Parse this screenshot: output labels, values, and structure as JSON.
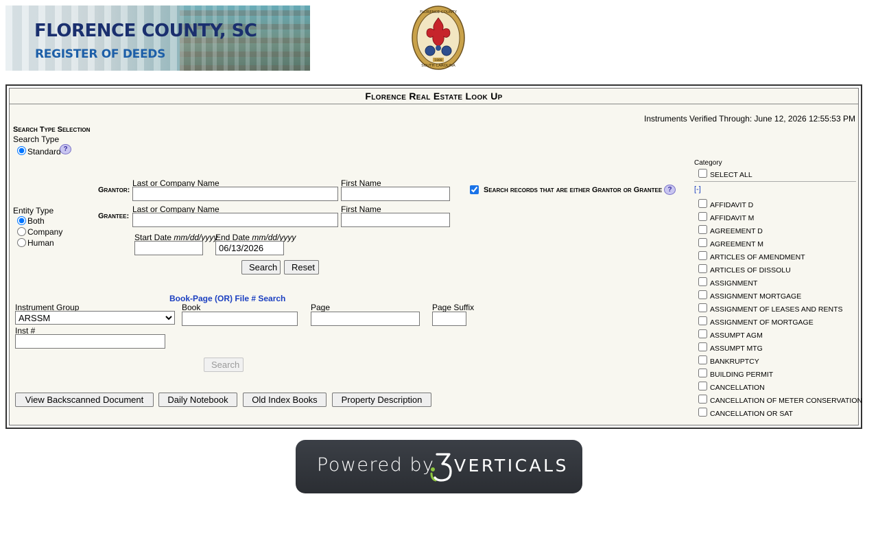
{
  "header": {
    "banner_line1": "FLORENCE COUNTY, SC",
    "banner_line2": "REGISTER OF DEEDS",
    "seal_top": "FLORENCE COUNTY",
    "seal_bottom": "SOUTH CAROLINA",
    "seal_year": "1888"
  },
  "panel": {
    "title": "Florence Real Estate Look Up",
    "verified": "Instruments Verified Through: June 12, 2026 12:55:53 PM"
  },
  "search_type": {
    "heading": "Search Type Selection",
    "label": "Search Type",
    "option": "Standard",
    "help": "?"
  },
  "entity": {
    "label": "Entity Type",
    "options": [
      "Both",
      "Company",
      "Human"
    ],
    "selected": "Both"
  },
  "names": {
    "grantor_label": "Grantor:",
    "grantee_label": "Grantee:",
    "last_label": "Last or Company Name",
    "first_label": "First Name",
    "grantor_last": "",
    "grantor_first": "",
    "grantee_last": "",
    "grantee_first": "",
    "either_label": "Search records that are either Grantor or Grantee",
    "either_checked": true
  },
  "dates": {
    "start_label": "Start Date",
    "start_format": "mm/dd/yyyy",
    "end_label": "End Date",
    "end_format": "mm/dd/yyyy",
    "start_value": "",
    "end_value": "06/13/2026"
  },
  "buttons": {
    "search": "Search",
    "reset": "Reset",
    "book_search": "Search",
    "view_backscanned": "View Backscanned Document",
    "daily_notebook": "Daily Notebook",
    "old_index_books": "Old Index Books",
    "property_description": "Property Description"
  },
  "book_page": {
    "heading": "Book-Page (OR) File # Search",
    "instrument_group_label": "Instrument Group",
    "instrument_group_value": "ARSSM",
    "book_label": "Book",
    "page_label": "Page",
    "suffix_label": "Page Suffix",
    "inst_label": "Inst #"
  },
  "category": {
    "label": "Category",
    "select_all": "SELECT ALL",
    "collapse": "[-]",
    "items": [
      "AFFIDAVIT D",
      "AFFIDAVIT M",
      "AGREEMENT D",
      "AGREEMENT M",
      "ARTICLES OF AMENDMENT",
      "ARTICLES OF DISSOLU",
      "ASSIGNMENT",
      "ASSIGNMENT MORTGAGE",
      "ASSIGNMENT OF LEASES AND RENTS",
      "ASSIGNMENT OF MORTGAGE",
      "ASSUMPT AGM",
      "ASSUMPT MTG",
      "BANKRUPTCY",
      "BUILDING PERMIT",
      "CANCELLATION",
      "CANCELLATION OF METER CONSERVATION",
      "CANCELLATION OR SAT"
    ]
  },
  "powered": {
    "text": "Powered by",
    "brand": "VERTICALS"
  }
}
